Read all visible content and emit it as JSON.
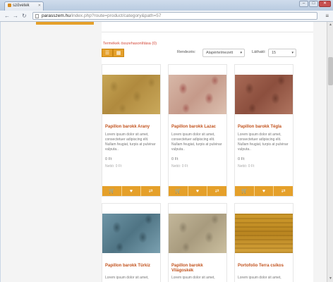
{
  "browser": {
    "tab_title": "szövetek",
    "url_host": "parasszem.hu",
    "url_path": "/index.php?route=product/category&path=57",
    "window_controls": [
      "minimize",
      "maximize",
      "close"
    ]
  },
  "toolbar": {
    "product_compare": "Termékek összehasonlítása (0)",
    "sort_label": "Rendezés:",
    "sort_value": "Alapértelmezett",
    "limit_label": "Látható:",
    "limit_value": "15"
  },
  "products": [
    {
      "name": "Papillon barokk Arany",
      "description": "Lorem ipsum dolor sit amet, consectetuer adipiscing elit. Nullam feugiat, turpis at pulvinar vulputa..",
      "price": "0 Ft",
      "tax": "Nettó: 0 Ft",
      "texture": "gold"
    },
    {
      "name": "Papillon barokk Lazac",
      "description": "Lorem ipsum dolor sit amet, consectetuer adipiscing elit. Nullam feugiat, turpis at pulvinar vulputa..",
      "price": "0 Ft",
      "tax": "Nettó: 0 Ft",
      "texture": "red"
    },
    {
      "name": "Papillon barokk Tégla",
      "description": "Lorem ipsum dolor sit amet, consectetuer adipiscing elit. Nullam feugiat, turpis at pulvinar vulputa..",
      "price": "0 Ft",
      "tax": "Nettó: 0 Ft",
      "texture": "brick"
    },
    {
      "name": "Papillon barokk Türkiz",
      "description": "Lorem ipsum dolor sit amet,",
      "texture": "teal"
    },
    {
      "name": "Papillon barokk Világoskék",
      "description": "Lorem ipsum dolor sit amet,",
      "texture": "beige"
    },
    {
      "name": "Portofolio Terra csíkos",
      "description": "Lorem ipsum dolor sit amet,",
      "texture": "stripe"
    }
  ],
  "colors": {
    "accent": "#e5a02a",
    "product_name": "#c2531e",
    "link": "#d3493a"
  }
}
